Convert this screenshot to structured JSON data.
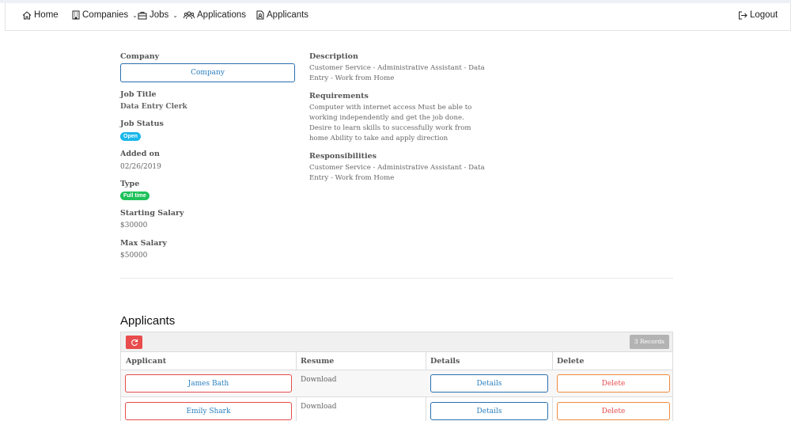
{
  "nav": {
    "home": "Home",
    "companies": "Companies",
    "jobs": "Jobs",
    "applications": "Applications",
    "applicants": "Applicants",
    "logout": "Logout"
  },
  "job": {
    "company_label": "Company",
    "company_button": "Company",
    "title_label": "Job Title",
    "title": "Data Entry Clerk",
    "status_label": "Job Status",
    "status": "Open",
    "added_label": "Added on",
    "added": "02/26/2019",
    "type_label": "Type",
    "type": "Full time",
    "starting_salary_label": "Starting Salary",
    "starting_salary": "$30000",
    "max_salary_label": "Max Salary",
    "max_salary": "$50000",
    "description_label": "Description",
    "description": "Customer Service - Administrative Assistant - Data Entry - Work from Home",
    "requirements_label": "Requirements",
    "requirements": "Computer with internet access Must be able to working independently and get the job done. Desire to learn skills to successfully work from home Ability to take and apply direction",
    "responsibilities_label": "Responsibilities",
    "responsibilities": "Customer Service - Administrative Assistant - Data Entry - Work from Home"
  },
  "applicants": {
    "title": "Applicants",
    "records": "3 Records",
    "columns": [
      "Applicant",
      "Resume",
      "Details",
      "Delete"
    ],
    "rows": [
      {
        "name": "James Bath",
        "resume": "Download",
        "details": "Details",
        "delete": "Delete"
      },
      {
        "name": "Emily Shark",
        "resume": "Download",
        "details": "Details",
        "delete": "Delete"
      }
    ]
  },
  "colors": {
    "primary": "#2a7fc0",
    "danger": "#e84c4c",
    "warning_outline": "#f08a3c",
    "badge_open": "#1ab7ea",
    "badge_fulltime": "#1fc15a"
  }
}
